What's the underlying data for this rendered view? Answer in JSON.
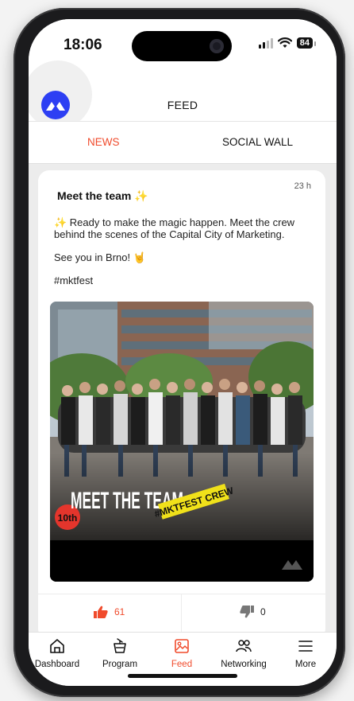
{
  "status": {
    "time": "18:06",
    "battery": "84"
  },
  "header": {
    "title": "FEED"
  },
  "tabs": {
    "news": "NEWS",
    "social": "SOCIAL WALL"
  },
  "post": {
    "time": "23 h",
    "title": "Meet the team ✨",
    "body": [
      "✨ Ready to make the magic happen. Meet the crew behind the scenes of the Capital City of Marketing.",
      "See you in Brno! 🤘",
      "#mktfest"
    ],
    "image": {
      "headline": "MEET THE TEAM",
      "tag": "#MKTFEST CREW",
      "badge": "10th"
    },
    "likes": "61",
    "dislikes": "0"
  },
  "bottom_nav": [
    {
      "label": "Dashboard",
      "icon": "home-icon"
    },
    {
      "label": "Program",
      "icon": "podium-icon"
    },
    {
      "label": "Feed",
      "icon": "image-icon",
      "active": true
    },
    {
      "label": "Networking",
      "icon": "people-icon"
    },
    {
      "label": "More",
      "icon": "menu-icon"
    }
  ],
  "colors": {
    "accent": "#f04b2c",
    "brand": "#2d3ff3"
  }
}
